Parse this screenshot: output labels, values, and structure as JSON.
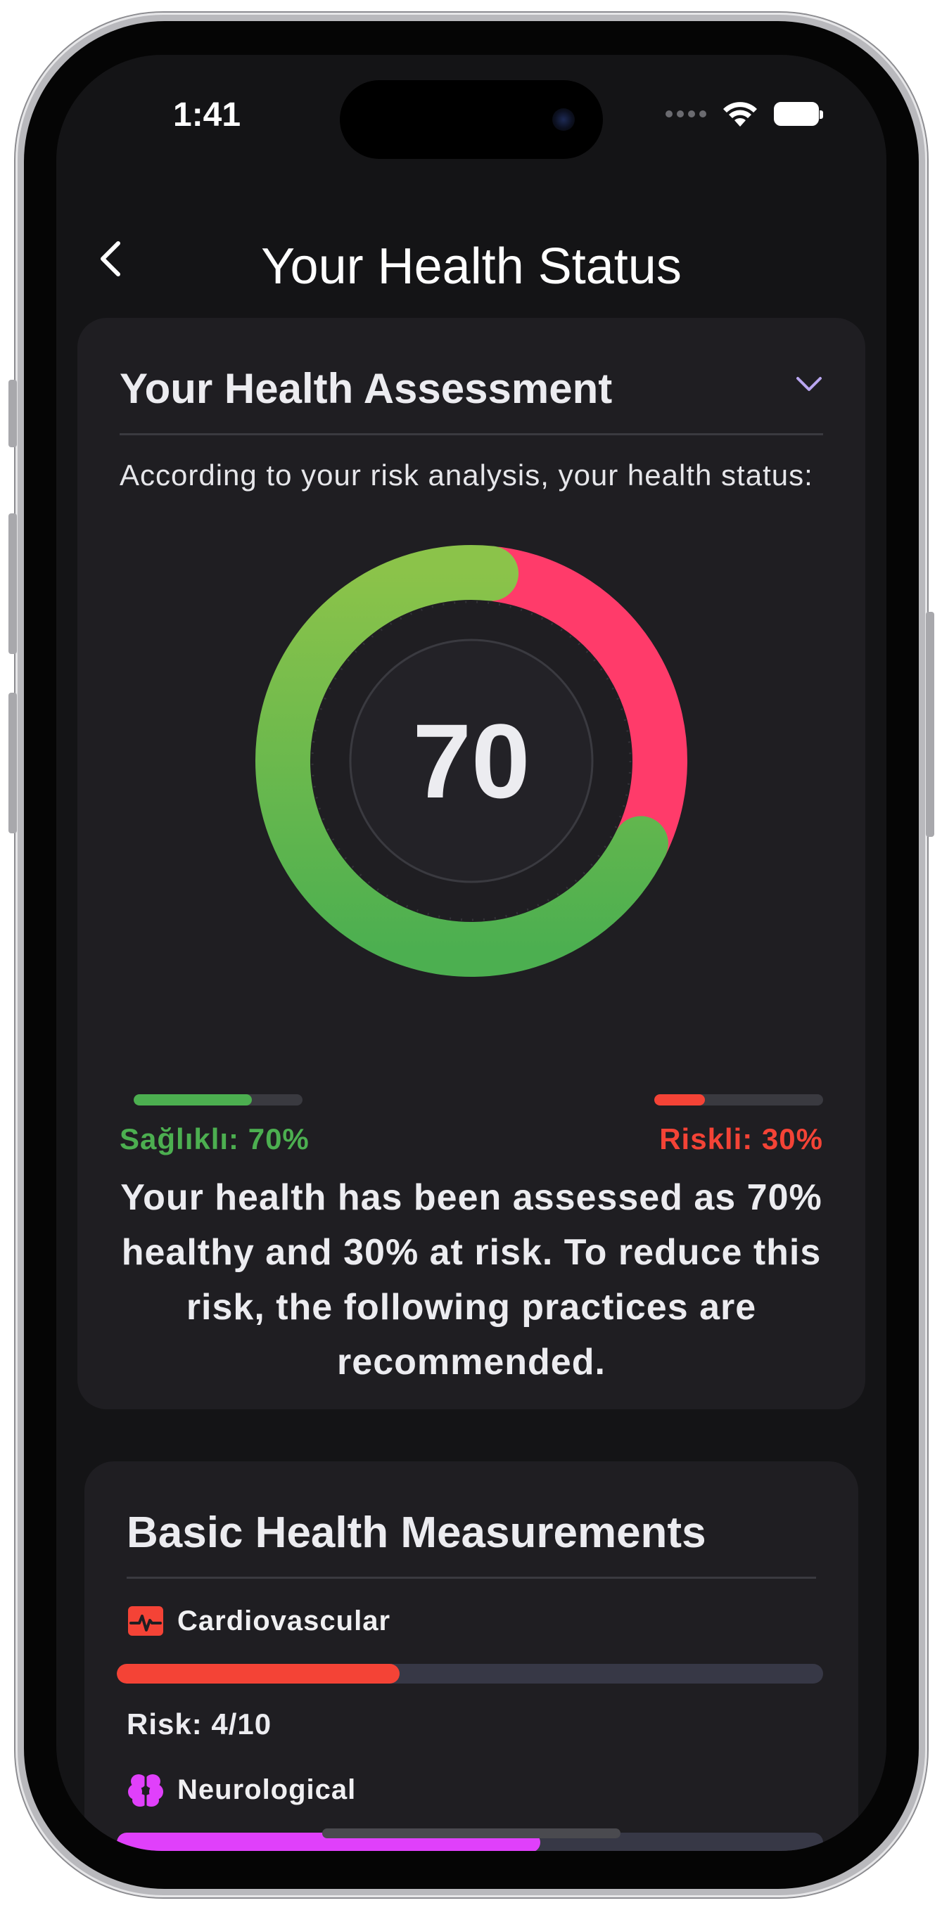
{
  "status_bar": {
    "time": "1:41"
  },
  "nav": {
    "title": "Your Health Status",
    "back_icon": "chevron-left-icon"
  },
  "assessment": {
    "title": "Your Health Assessment",
    "subtitle": "According to your risk analysis, your health status:",
    "score": "70",
    "healthy_percent": 70,
    "risk_percent": 30,
    "healthy_label": "Sağlıklı: 70%",
    "risk_label": "Riskli: 30%",
    "summary": "Your health has been assessed as 70% healthy and 30% at risk. To reduce this risk, the following practices are recommended.",
    "colors": {
      "healthy": "#4CAF50",
      "healthy_light": "#8BC34A",
      "risk": "#FF3B6A",
      "risk_bar": "#F44336"
    }
  },
  "measurements": {
    "title": "Basic Health Measurements",
    "items": [
      {
        "icon": "heart-pulse-icon",
        "label": "Cardiovascular",
        "risk_value": 4,
        "risk_max": 10,
        "risk_text": "Risk: 4/10",
        "color": "#F44336"
      },
      {
        "icon": "brain-icon",
        "label": "Neurological",
        "risk_value": 6,
        "risk_max": 10,
        "color": "#E040FB"
      }
    ]
  }
}
